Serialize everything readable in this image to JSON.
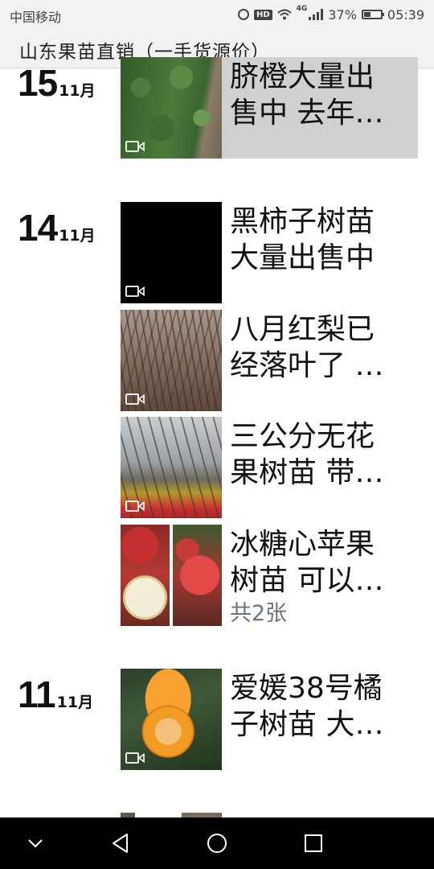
{
  "status_bar": {
    "carrier": "中国移动",
    "network": "4G",
    "battery": "37%",
    "battery_level": 0.37,
    "time": "05:39"
  },
  "header": {
    "title": "山东果苗直销（一手货源价）"
  },
  "feed": [
    {
      "day": "15",
      "month": "11月",
      "posts": [
        {
          "lines": [
            "脐橙大量出",
            "售中 去年…"
          ],
          "video": true,
          "image": "orange-orchard"
        }
      ]
    },
    {
      "day": "14",
      "month": "11月",
      "posts": [
        {
          "lines": [
            "黑柿子树苗",
            "大量出售中"
          ],
          "video": true,
          "image": "black-frame"
        },
        {
          "lines": [
            "八月红梨已",
            "经落叶了 …"
          ],
          "video": true,
          "image": "pear-saplings"
        },
        {
          "lines": [
            "三公分无花",
            "果树苗 带…"
          ],
          "video": true,
          "image": "fig-saplings"
        },
        {
          "lines": [
            "冰糖心苹果",
            "树苗 可以发…"
          ],
          "video": false,
          "image": "apples",
          "count": "共2张"
        }
      ]
    },
    {
      "day": "11",
      "month": "11月",
      "posts": [
        {
          "lines": [
            "爱媛38号橘",
            "子树苗 大…"
          ],
          "video": true,
          "image": "mandarin"
        }
      ]
    }
  ],
  "nav_bar": {
    "icons": [
      "chevron-down-icon",
      "back-icon",
      "home-icon",
      "recents-icon"
    ]
  },
  "colors": {
    "bar_background": "#f2f2f2",
    "highlight": "#d0d0d0",
    "count_text": "#6b7280"
  }
}
